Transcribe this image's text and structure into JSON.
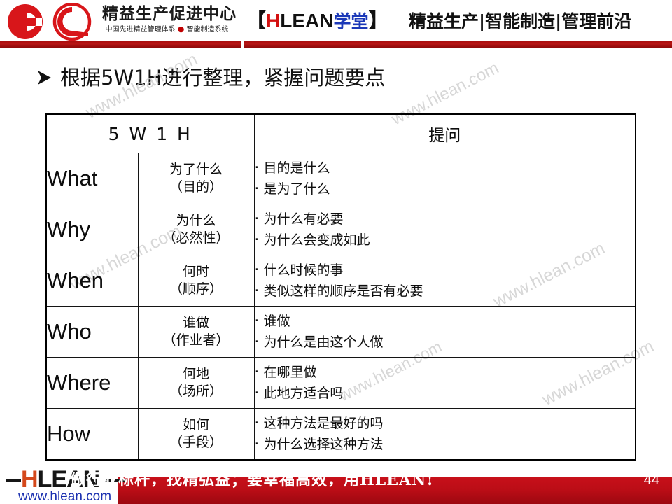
{
  "header": {
    "logo_icon": "hlean-circles-logo",
    "brand_cn_main": "精益生产促进中心",
    "brand_cn_sub_left": "中国先进精益管理体系",
    "brand_cn_sub_dot": "●",
    "brand_cn_sub_right": "智能制造系统",
    "hlean_bracket_open": "【",
    "hlean_h": "H",
    "hlean_lean": "LEAN",
    "hlean_xuetang": "学堂",
    "hlean_bracket_close": "】",
    "tagline": "精益生产|智能制造|管理前沿",
    "rule_color": "#b01212"
  },
  "slide": {
    "bullet_icon": "arrow-bullet-icon",
    "title": "根据5W1H进行整理，紧握问题要点"
  },
  "table": {
    "header": {
      "col_group_label": "5 W 1 H",
      "col_ask_label": "提问"
    },
    "rows": [
      {
        "key": "What",
        "meaning_main": "为了什么",
        "meaning_sub": "（目的）",
        "asks": [
          "目的是什么",
          "是为了什么"
        ]
      },
      {
        "key": "Why",
        "meaning_main": "为什么",
        "meaning_sub": "（必然性）",
        "asks": [
          "为什么有必要",
          "为什么会变成如此"
        ]
      },
      {
        "key": "When",
        "meaning_main": "何时",
        "meaning_sub": "（顺序）",
        "asks": [
          "什么时候的事",
          "类似这样的顺序是否有必要"
        ]
      },
      {
        "key": "Who",
        "meaning_main": "谁做",
        "meaning_sub": "（作业者）",
        "asks": [
          "谁做",
          "为什么是由这个人做"
        ]
      },
      {
        "key": "Where",
        "meaning_main": "何地",
        "meaning_sub": "（场所）",
        "asks": [
          "在哪里做",
          "此地方适合吗"
        ]
      },
      {
        "key": "How",
        "meaning_main": "如何",
        "meaning_sub": "（手段）",
        "asks": [
          "这种方法是最好的吗",
          "为什么选择这种方法"
        ]
      }
    ]
  },
  "watermarks": [
    "www.hlean.com",
    "www.hlean.com",
    "www.hlean.com",
    "www.hlean.com",
    "www.hlean.com",
    "www.hlean.com"
  ],
  "footer": {
    "logo_h": "H",
    "logo_lean": "LEAN",
    "logo_url": "www.hlean.com",
    "banner_text": "做行业标杆，找精弘益；要幸福高效，用HLEAN!",
    "page_number": "44",
    "banner_color": "#ba0d16"
  }
}
